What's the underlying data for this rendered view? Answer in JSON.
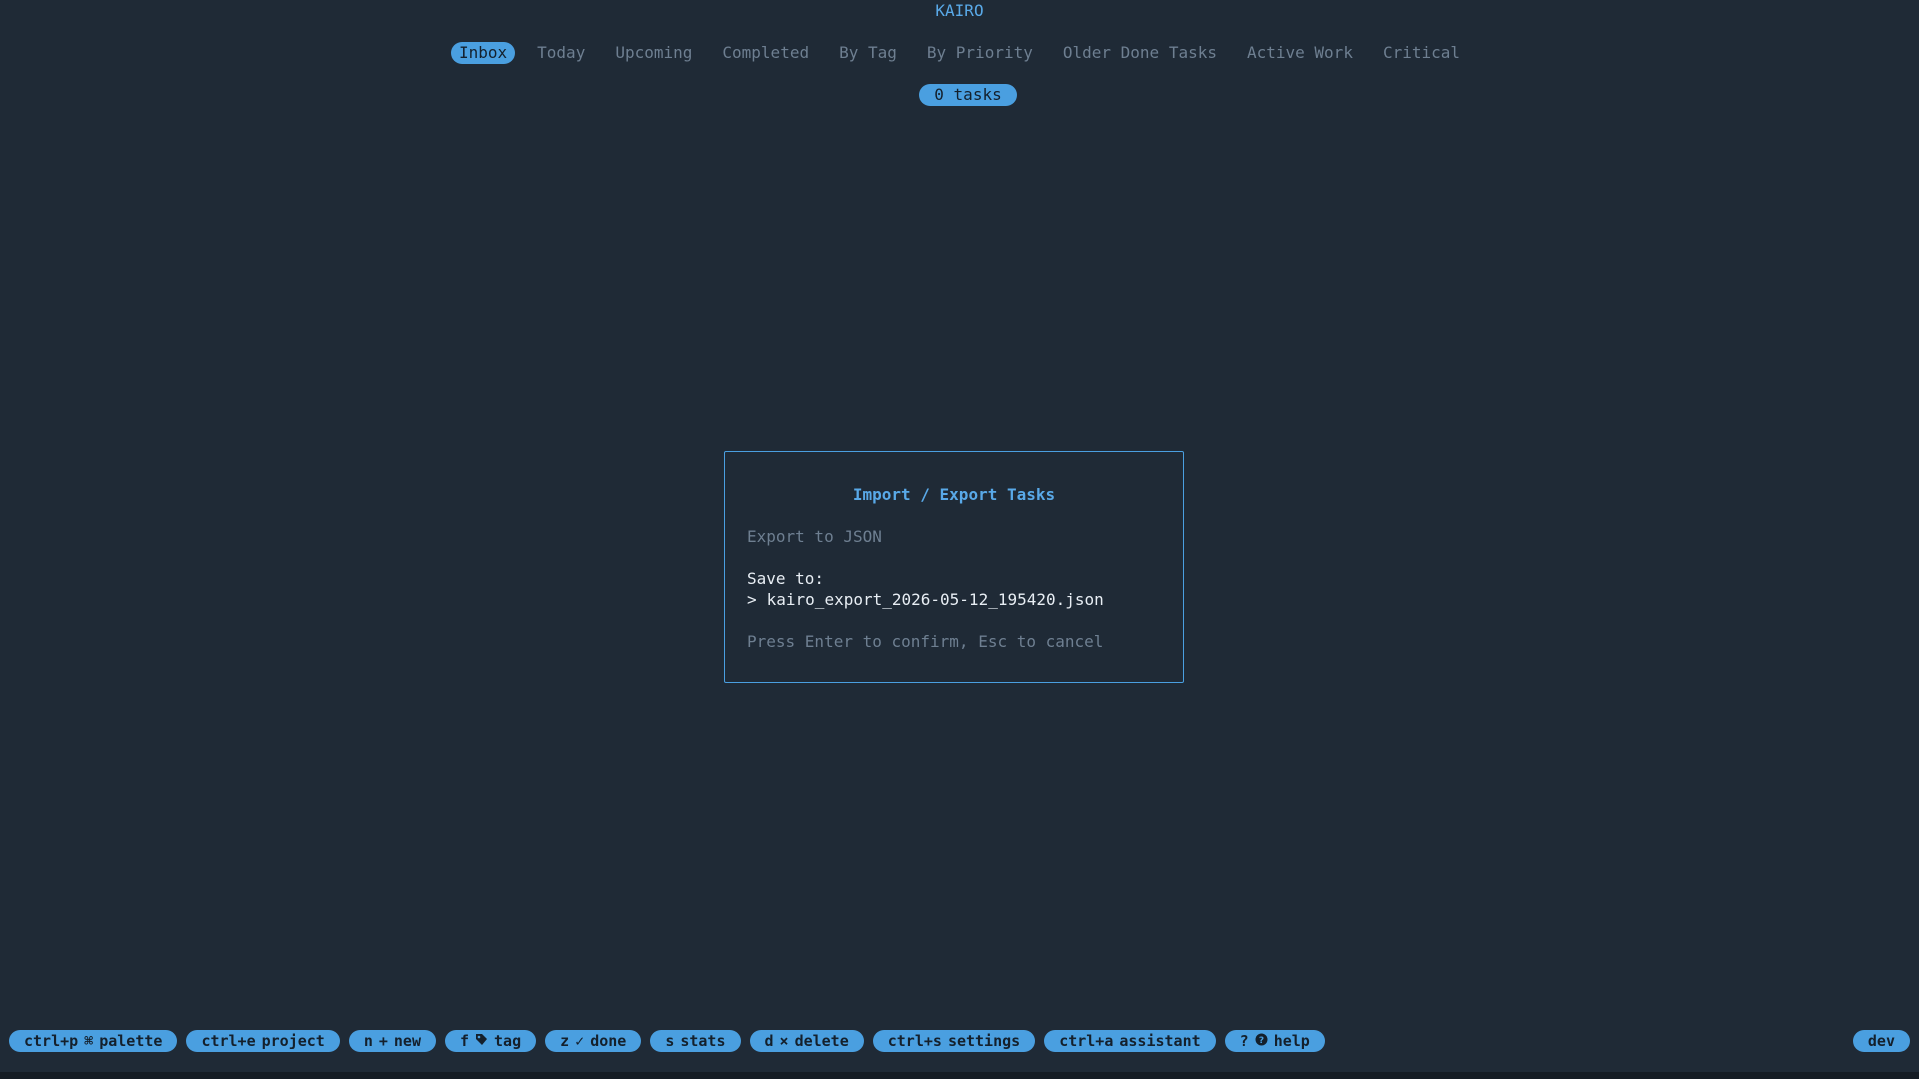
{
  "app": {
    "title": "KAIRO"
  },
  "tabs": [
    {
      "label": "Inbox",
      "active": true
    },
    {
      "label": "Today"
    },
    {
      "label": "Upcoming"
    },
    {
      "label": "Completed"
    },
    {
      "label": "By Tag"
    },
    {
      "label": "By Priority"
    },
    {
      "label": "Older Done Tasks"
    },
    {
      "label": "Active Work"
    },
    {
      "label": "Critical"
    }
  ],
  "task_count": "0 tasks",
  "dialog": {
    "title": "Import / Export Tasks",
    "subtitle": "Export to JSON",
    "save_label": "Save to:",
    "prompt": ">",
    "path_value": "kairo_export_2026-05-12_195420.json",
    "hint": "Press Enter to confirm, Esc to cancel"
  },
  "shortcuts": [
    {
      "key": "ctrl+p",
      "icon": "⌘",
      "icon_name": "command-icon",
      "label": "palette"
    },
    {
      "key": "ctrl+e",
      "icon": "",
      "label": "project"
    },
    {
      "key": "n",
      "icon": "+",
      "icon_name": "plus-icon",
      "label": "new"
    },
    {
      "key": "f",
      "icon": "🏷",
      "icon_name": "tag-icon",
      "label": "tag"
    },
    {
      "key": "z",
      "icon": "✓",
      "icon_name": "check-icon",
      "label": "done"
    },
    {
      "key": "s",
      "icon": "",
      "label": "stats"
    },
    {
      "key": "d",
      "icon": "×",
      "icon_name": "close-icon",
      "label": "delete"
    },
    {
      "key": "ctrl+s",
      "icon": "",
      "label": "settings"
    },
    {
      "key": "ctrl+a",
      "icon": "",
      "label": "assistant"
    },
    {
      "key": "?",
      "icon": "❓",
      "icon_name": "question-circle-icon",
      "label": "help"
    }
  ],
  "env": "dev",
  "colors": {
    "background": "#1f2a36",
    "accent": "#4a9fe0",
    "muted_text": "#6e7f91",
    "text": "#e8eef4"
  }
}
